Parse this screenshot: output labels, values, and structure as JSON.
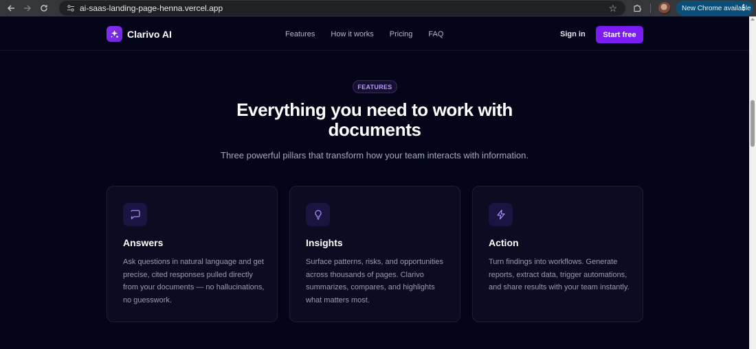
{
  "browser": {
    "url": "ai-saas-landing-page-henna.vercel.app",
    "update_label": "New Chrome available"
  },
  "header": {
    "brand": "Clarivo AI",
    "nav": [
      "Features",
      "How it works",
      "Pricing",
      "FAQ"
    ],
    "sign_in": "Sign in",
    "cta": "Start free"
  },
  "hero": {
    "badge": "FEATURES",
    "title": "Everything you need to work with documents",
    "subtitle": "Three powerful pillars that transform how your team interacts with information."
  },
  "features": [
    {
      "icon": "chat-bubble-icon",
      "title": "Answers",
      "description": "Ask questions in natural language and get precise, cited responses pulled directly from your documents — no hallucinations, no guesswork."
    },
    {
      "icon": "lightbulb-icon",
      "title": "Insights",
      "description": "Surface patterns, risks, and opportunities across thousands of pages. Clarivo summarizes, compares, and highlights what matters most."
    },
    {
      "icon": "lightning-bolt-icon",
      "title": "Action",
      "description": "Turn findings into workflows. Generate reports, extract data, trigger automations, and share results with your team instantly."
    }
  ],
  "colors": {
    "background": "#05051a",
    "accent": "#7c1cf5",
    "card": "#0b0b21",
    "icon": "#a78bfa"
  }
}
